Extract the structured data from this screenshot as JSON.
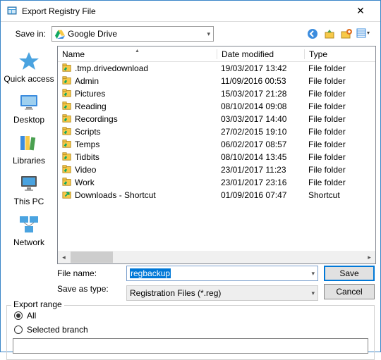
{
  "titlebar": {
    "title": "Export Registry File"
  },
  "savein": {
    "label": "Save in:",
    "value": "Google Drive"
  },
  "sidebar": [
    {
      "label": "Quick access"
    },
    {
      "label": "Desktop"
    },
    {
      "label": "Libraries"
    },
    {
      "label": "This PC"
    },
    {
      "label": "Network"
    }
  ],
  "columns": {
    "name": "Name",
    "date": "Date modified",
    "type": "Type"
  },
  "files": [
    {
      "name": ".tmp.drivedownload",
      "date": "19/03/2017 13:42",
      "type": "File folder"
    },
    {
      "name": "Admin",
      "date": "11/09/2016 00:53",
      "type": "File folder"
    },
    {
      "name": "Pictures",
      "date": "15/03/2017 21:28",
      "type": "File folder"
    },
    {
      "name": "Reading",
      "date": "08/10/2014 09:08",
      "type": "File folder"
    },
    {
      "name": "Recordings",
      "date": "03/03/2017 14:40",
      "type": "File folder"
    },
    {
      "name": "Scripts",
      "date": "27/02/2015 19:10",
      "type": "File folder"
    },
    {
      "name": "Temps",
      "date": "06/02/2017 08:57",
      "type": "File folder"
    },
    {
      "name": "Tidbits",
      "date": "08/10/2014 13:45",
      "type": "File folder"
    },
    {
      "name": "Video",
      "date": "23/01/2017 11:23",
      "type": "File folder"
    },
    {
      "name": "Work",
      "date": "23/01/2017 23:16",
      "type": "File folder"
    },
    {
      "name": "Downloads - Shortcut",
      "date": "01/09/2016 07:47",
      "type": "Shortcut",
      "shortcut": true
    }
  ],
  "filename": {
    "label": "File name:",
    "value": "regbackup"
  },
  "saveastype": {
    "label": "Save as type:",
    "value": "Registration Files (*.reg)"
  },
  "buttons": {
    "save": "Save",
    "cancel": "Cancel"
  },
  "export": {
    "legend": "Export range",
    "all": "All",
    "selected": "Selected branch",
    "branch_value": ""
  }
}
